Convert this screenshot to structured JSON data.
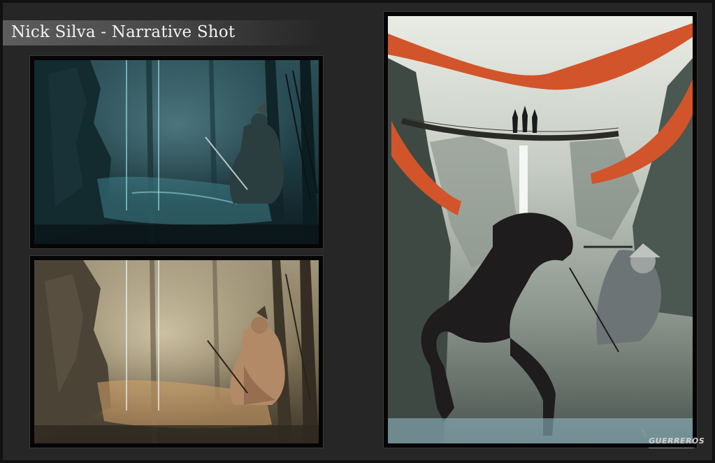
{
  "header": {
    "title": "Nick Silva - Narrative Shot"
  },
  "panels": [
    {
      "id": "top-left",
      "subject": "night-jungle-scene"
    },
    {
      "id": "bottom-left",
      "subject": "day-jungle-scene"
    },
    {
      "id": "right",
      "subject": "horseman-bridge-scene"
    }
  ],
  "watermark": {
    "text": "GUERREROS"
  },
  "colors": {
    "background": "#262626",
    "banner": "#555555",
    "accent_orange": "#d2542a",
    "night_teal": "#24464d",
    "day_sepia": "#8a7a5a"
  }
}
